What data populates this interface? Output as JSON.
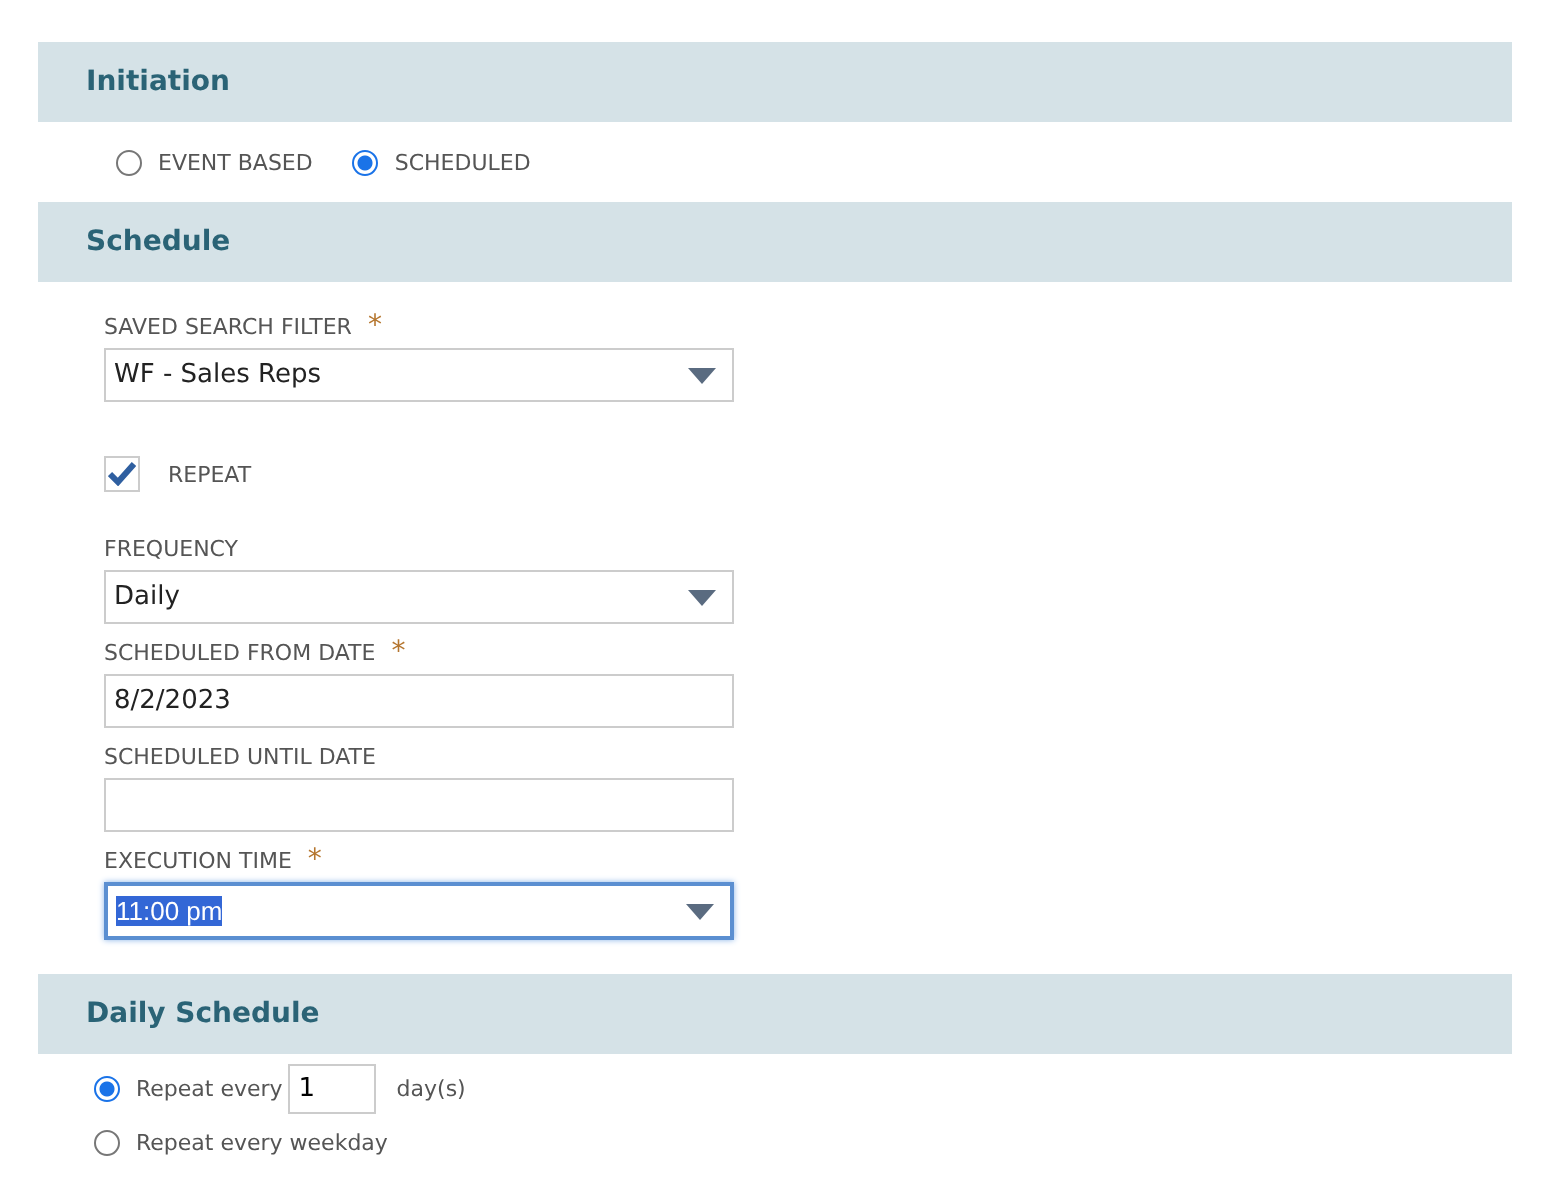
{
  "sections": [
    {
      "title": "Initiation",
      "kind": "radio_row",
      "options": [
        {
          "label": "EVENT BASED",
          "selected": false
        },
        {
          "label": "SCHEDULED",
          "selected": true
        }
      ]
    },
    {
      "title": "Schedule",
      "kind": "form",
      "fields": [
        {
          "kind": "select",
          "label": "SAVED SEARCH FILTER",
          "required_mark": "*",
          "value": "WF - Sales Reps"
        },
        {
          "kind": "checkbox",
          "label": "REPEAT",
          "checked": true
        },
        {
          "kind": "select",
          "label": "FREQUENCY",
          "value": "Daily"
        },
        {
          "kind": "text",
          "label": "SCHEDULED FROM DATE",
          "required_mark": "*",
          "value": "8/2/2023"
        },
        {
          "kind": "text",
          "label": "SCHEDULED UNTIL DATE"
        },
        {
          "kind": "select",
          "label": "EXECUTION TIME",
          "required_mark": "*",
          "value": "11:00 pm",
          "focused": true
        }
      ]
    },
    {
      "title": "Daily Schedule",
      "kind": "radio_list",
      "options": [
        {
          "label": "Repeat every",
          "selected": true,
          "count": "1",
          "unit": "day(s)"
        },
        {
          "label": "Repeat every weekday",
          "selected": false
        }
      ]
    }
  ]
}
